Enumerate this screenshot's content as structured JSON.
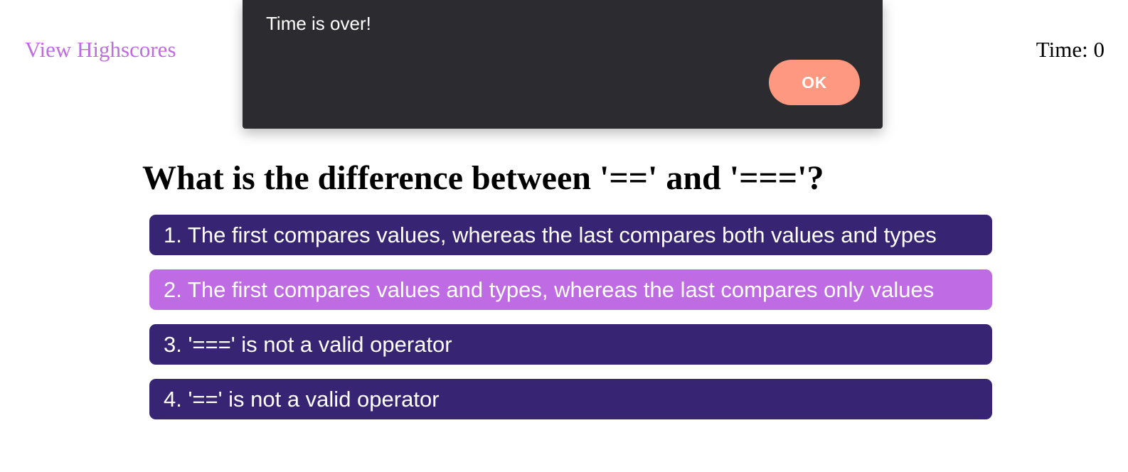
{
  "header": {
    "highscores_link": "View Highscores",
    "timer_text": "Time: 0"
  },
  "dialog": {
    "message": "Time is over!",
    "ok_label": "OK"
  },
  "quiz": {
    "question": "What is the difference between '==' and '==='?",
    "answers": [
      {
        "label": "1. The first compares values, whereas the last compares both values and types"
      },
      {
        "label": "2. The first compares values and types, whereas the last compares only values"
      },
      {
        "label": "3. '===' is not a valid operator"
      },
      {
        "label": "4. '==' is not a valid operator"
      }
    ]
  },
  "colors": {
    "link": "#bf6be3",
    "answer_background": "#372472",
    "answer_highlight": "#bf6be3",
    "dialog_background": "#2c2c30",
    "dialog_button": "#ff9880"
  }
}
